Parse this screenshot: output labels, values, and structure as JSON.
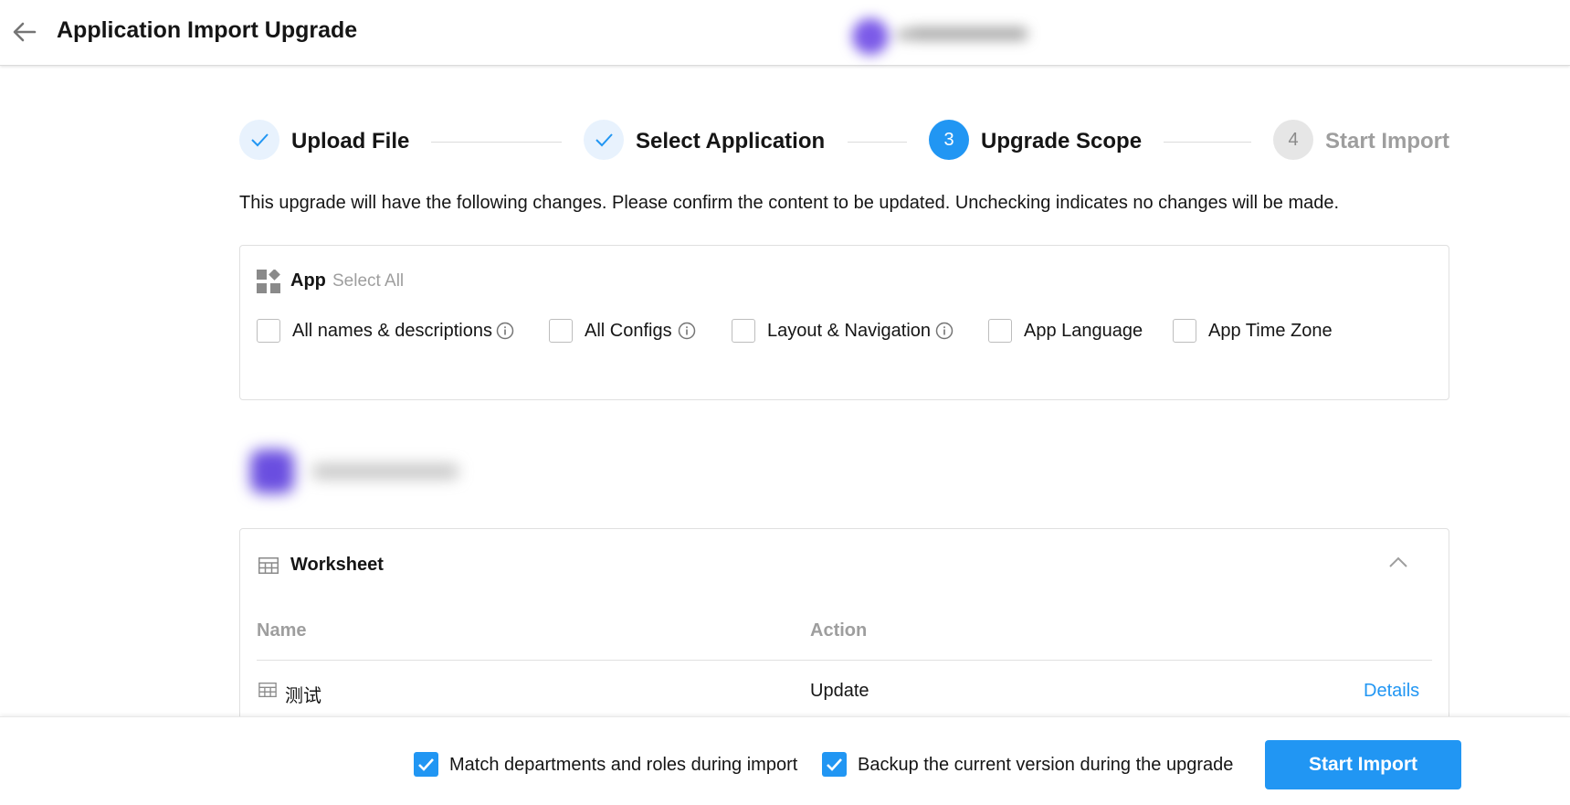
{
  "header": {
    "title": "Application Import Upgrade"
  },
  "steps": [
    {
      "label": "Upload File",
      "state": "done",
      "number": ""
    },
    {
      "label": "Select Application",
      "state": "done",
      "number": ""
    },
    {
      "label": "Upgrade Scope",
      "state": "active",
      "number": "3"
    },
    {
      "label": "Start Import",
      "state": "todo",
      "number": "4"
    }
  ],
  "description": "This upgrade will have the following changes. Please confirm the content to be updated. Unchecking indicates no changes will be made.",
  "app_section": {
    "title": "App",
    "select_all": "Select All",
    "options": [
      {
        "label": "All names & descriptions",
        "checked": false,
        "info": true
      },
      {
        "label": "All Configs",
        "checked": false,
        "info": true
      },
      {
        "label": "Layout & Navigation",
        "checked": false,
        "info": true
      },
      {
        "label": "App Language",
        "checked": false,
        "info": false
      },
      {
        "label": "App Time Zone",
        "checked": false,
        "info": false
      }
    ]
  },
  "worksheet_section": {
    "title": "Worksheet",
    "columns": [
      "Name",
      "Action"
    ],
    "rows": [
      {
        "name": "测试",
        "action": "Update",
        "link": "Details"
      }
    ]
  },
  "footer": {
    "match_label": "Match departments and roles during import",
    "match_checked": true,
    "backup_label": "Backup the current version during the upgrade",
    "backup_checked": true,
    "start_button": "Start Import"
  },
  "colors": {
    "accent": "#2196f3",
    "text": "#151515",
    "muted": "#9e9e9e"
  }
}
